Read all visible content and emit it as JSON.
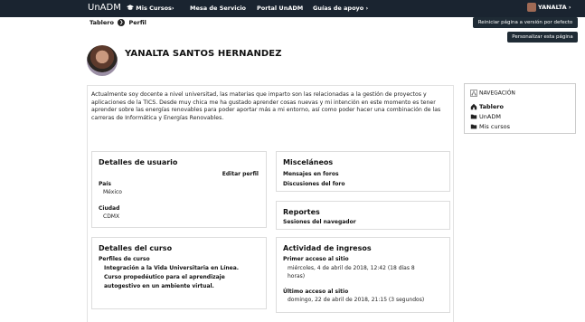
{
  "topbar": {
    "brand": "UnADM",
    "menu": [
      {
        "label": "Mis Cursos",
        "suffix": "›",
        "icon": "graduation-cap-icon"
      },
      {
        "label": "Mesa de Servicio",
        "suffix": ""
      },
      {
        "label": "Portal UnADM",
        "suffix": ""
      },
      {
        "label": "Guías de apoyo",
        "suffix": "›"
      }
    ],
    "user": "YANALTA",
    "user_suffix": "›"
  },
  "breadcrumb": {
    "home": "Tablero",
    "separator": "❯",
    "current": "Perfil"
  },
  "buttons": {
    "reset": "Reiniciar página a versión por defecto",
    "customize": "Personalizar esta página"
  },
  "profile": {
    "name": "YANALTA SANTOS HERNANDEZ",
    "description": "Actualmente soy docente a nivel universitad, las materias que imparto son las relacionadas a la gestión de proyectos y aplicaciones de la TICS. Desde muy chica me ha gustado aprender cosas nuevas y mi intención en este momento es tener aprender sobre las energías renovables para poder aportar más a mi entorno, así como poder hacer una combinación de las carreras de Informática y Energías Renovables."
  },
  "user_details": {
    "title": "Detalles de usuario",
    "edit": "Editar perfil",
    "country_label": "País",
    "country": "México",
    "city_label": "Ciudad",
    "city": "CDMX"
  },
  "misc": {
    "title": "Misceláneos",
    "items": [
      "Mensajes en foros",
      "Discusiones del foro"
    ]
  },
  "reports": {
    "title": "Reportes",
    "items": [
      "Sesiones del navegador"
    ]
  },
  "course_details": {
    "title": "Detalles del curso",
    "profiles_label": "Perfiles de curso",
    "courses": [
      "Integración a la Vida Universitaria en Línea.",
      "Curso propedéutico para el aprendizaje",
      "autogestivo en un ambiente virtual."
    ]
  },
  "activity": {
    "title": "Actividad de ingresos",
    "first_label": "Primer acceso al sitio",
    "first_value_1": "miércoles, 4 de abril de 2018, 12:42  (18 días 8",
    "first_value_2": "horas)",
    "last_label": "Último acceso al sitio",
    "last_value": "domingo, 22 de abril de 2018, 21:15  (3 segundos)"
  },
  "navigation": {
    "title": "NAVEGACIÓN",
    "items": [
      {
        "label": "Tablero",
        "icon": "home-icon"
      },
      {
        "label": "UnADM",
        "icon": "folder-icon"
      },
      {
        "label": "Mis cursos",
        "icon": "folder-icon"
      }
    ]
  },
  "colors": {
    "topbar": "#1a2430",
    "button": "#1f2b35",
    "page": "#ffffff",
    "background": "#e9eaec"
  }
}
